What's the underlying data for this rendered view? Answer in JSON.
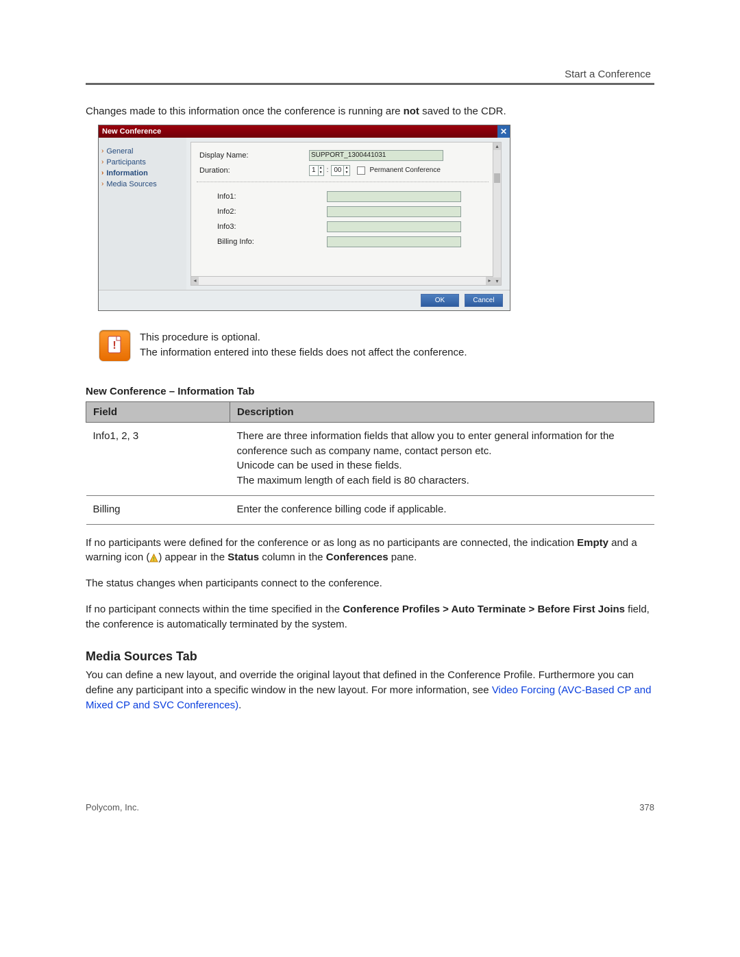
{
  "header": {
    "right": "Start a Conference"
  },
  "lead": {
    "before": "Changes made to this information once the conference is running are ",
    "bold": "not",
    "after": " saved to the CDR."
  },
  "dialog": {
    "title": "New Conference",
    "close": "✕",
    "sidebar": {
      "items": [
        {
          "label": "General",
          "selected": false
        },
        {
          "label": "Participants",
          "selected": false
        },
        {
          "label": "Information",
          "selected": true
        },
        {
          "label": "Media Sources",
          "selected": false
        }
      ]
    },
    "form": {
      "display_name_label": "Display Name:",
      "display_name_value": "SUPPORT_1300441031",
      "duration_label": "Duration:",
      "duration_hours": "1",
      "duration_sep": ":",
      "duration_mins": "00",
      "permanent_label": "Permanent Conference",
      "info1_label": "Info1:",
      "info2_label": "Info2:",
      "info3_label": "Info3:",
      "billing_label": "Billing Info:"
    },
    "buttons": {
      "ok": "OK",
      "cancel": "Cancel"
    }
  },
  "note": {
    "line1": "This procedure is optional.",
    "line2": "The information entered into these fields does not affect the conference."
  },
  "table": {
    "caption": "New Conference – Information Tab",
    "head": {
      "field": "Field",
      "desc": "Description"
    },
    "rows": [
      {
        "field": "Info1, 2, 3",
        "d1": "There are three information fields that allow you to enter general information for the conference such as company name, contact person etc.",
        "d2": "Unicode can be used in these fields.",
        "d3": "The maximum length of each field is 80 characters."
      },
      {
        "field": "Billing",
        "d1": "Enter the conference billing code if applicable."
      }
    ]
  },
  "p1": {
    "a": "If no participants were defined for the conference or as long as no participants are connected, the indication ",
    "b": "Empty",
    "c": " and a warning icon (",
    "d": ") appear in the ",
    "e": "Status",
    "f": " column in the ",
    "g": "Conferences",
    "h": " pane."
  },
  "p2": "The status changes when participants connect to the conference.",
  "p3": {
    "a": "If no participant connects within the time specified in the ",
    "b": "Conference Profiles > Auto Terminate > Before First Joins",
    "c": " field, the conference is automatically terminated by the system."
  },
  "h2": "Media Sources Tab",
  "p4": {
    "a": "You can define a new layout, and override the original layout that defined in the Conference Profile. Furthermore you can define any participant into a specific window in the new layout. For more information, see ",
    "link": "Video Forcing (AVC-Based CP and Mixed CP and SVC Conferences)",
    "tail": "."
  },
  "footer": {
    "left": "Polycom, Inc.",
    "right": "378"
  }
}
